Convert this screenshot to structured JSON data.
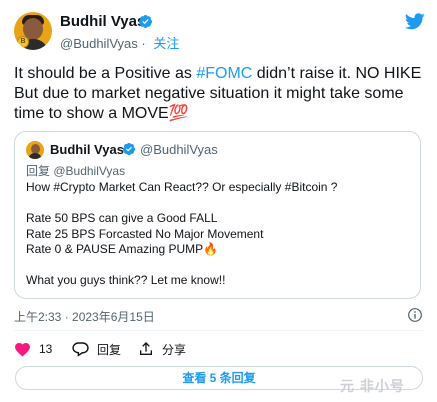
{
  "author": {
    "name": "Budhil Vyas",
    "handle": "@BudhilVyas",
    "follow_label": "关注"
  },
  "tweet": {
    "text_before": "It should be a Positive as ",
    "hashtag": "#FOMC",
    "text_after": " didn’t raise it. NO HIKE But due to market negative situation it might take some time to show a MOVE",
    "emoji": "💯"
  },
  "quote": {
    "name": "Budhil Vyas",
    "handle": "@BudhilVyas",
    "reply_label": "回复 @BudhilVyas",
    "lines": [
      "How #Crypto Market Can React?? Or especially #Bitcoin ?",
      "",
      "Rate 50 BPS can give a Good FALL",
      "Rate 25 BPS Forcasted No Major Movement",
      "Rate 0 & PAUSE Amazing PUMP🔥",
      "",
      "What you guys think?? Let me know!!"
    ]
  },
  "timestamp": "上午2:33 · 2023年6月15日",
  "actions": {
    "like_count": "13",
    "reply_label": "回复",
    "share_label": "分享"
  },
  "view_replies_label": "查看 5 条回复",
  "watermark": "元 非小号",
  "colors": {
    "accent": "#1d9bf0",
    "like": "#f91880",
    "text": "#0f1419",
    "muted": "#536471",
    "border": "#cfd9de"
  }
}
